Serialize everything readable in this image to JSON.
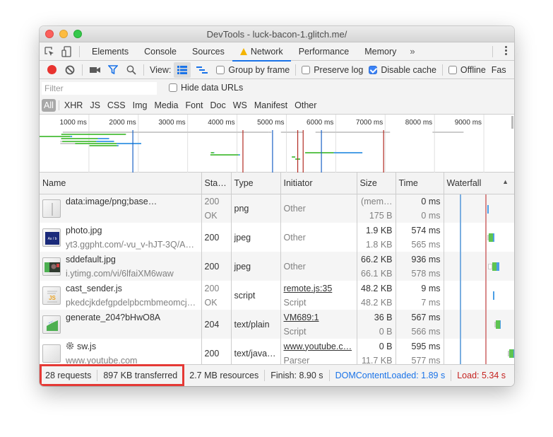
{
  "window": {
    "title": "DevTools - luck-bacon-1.glitch.me/"
  },
  "tabs": [
    {
      "label": "Elements",
      "active": false
    },
    {
      "label": "Console",
      "active": false
    },
    {
      "label": "Sources",
      "active": false
    },
    {
      "label": "Network",
      "active": true,
      "warning": true
    },
    {
      "label": "Performance",
      "active": false
    },
    {
      "label": "Memory",
      "active": false
    }
  ],
  "tabbar": {
    "more_tabs": "»"
  },
  "toolbar": {
    "view_label": "View:",
    "group_by_frame": {
      "label": "Group by frame",
      "checked": false
    },
    "preserve_log": {
      "label": "Preserve log",
      "checked": false
    },
    "disable_cache": {
      "label": "Disable cache",
      "checked": true
    },
    "offline": {
      "label": "Offline",
      "checked": false
    },
    "throttling": "Fas"
  },
  "filter": {
    "placeholder": "Filter",
    "value": "",
    "hide_data_urls": {
      "label": "Hide data URLs",
      "checked": false
    },
    "types": [
      "All",
      "XHR",
      "JS",
      "CSS",
      "Img",
      "Media",
      "Font",
      "Doc",
      "WS",
      "Manifest",
      "Other"
    ],
    "active_type": "All"
  },
  "overview": {
    "ticks": [
      "1000 ms",
      "2000 ms",
      "3000 ms",
      "4000 ms",
      "5000 ms",
      "6000 ms",
      "7000 ms",
      "8000 ms",
      "9000 ms"
    ],
    "dom_content_loaded_ms": 1890,
    "load_ms": 5340,
    "colors": {
      "waiting": "#5ec450",
      "download": "#4c9fe6",
      "queued": "#cccccc",
      "dcl": "#1a62c6",
      "load": "#b22b22"
    }
  },
  "columns": {
    "name": "Name",
    "status": "Sta…",
    "type": "Type",
    "initiator": "Initiator",
    "size": "Size",
    "time": "Time",
    "waterfall": "Waterfall",
    "sort_indicator": "▲"
  },
  "requests": [
    {
      "name": "data:image/png;base…",
      "path": "",
      "thumb": "blank-image",
      "status": "200",
      "status_text": "OK",
      "type": "png",
      "initiator": "Other",
      "initiator_sub": "",
      "initiator_link": false,
      "size": "(mem…",
      "size_sub": "175 B",
      "time": "0 ms",
      "time_sub": "0 ms"
    },
    {
      "name": "photo.jpg",
      "path": "yt3.ggpht.com/-vu_v-hJT-3Q/A…",
      "thumb": "photo-image",
      "status": "200",
      "status_text": "",
      "type": "jpeg",
      "initiator": "Other",
      "initiator_sub": "",
      "initiator_link": false,
      "size": "1.9 KB",
      "size_sub": "1.8 KB",
      "time": "574 ms",
      "time_sub": "565 ms"
    },
    {
      "name": "sddefault.jpg",
      "path": "i.ytimg.com/vi/6lfaiXM6waw",
      "thumb": "video-thumbnail",
      "status": "200",
      "status_text": "",
      "type": "jpeg",
      "initiator": "Other",
      "initiator_sub": "",
      "initiator_link": false,
      "size": "66.2 KB",
      "size_sub": "66.1 KB",
      "time": "936 ms",
      "time_sub": "578 ms"
    },
    {
      "name": "cast_sender.js",
      "path": "pkedcjkdefgpdelpbcmbmeomcj…",
      "thumb": "js-file",
      "status": "200",
      "status_text": "OK",
      "type": "script",
      "initiator": "remote.js:35",
      "initiator_sub": "Script",
      "initiator_link": true,
      "size": "48.2 KB",
      "size_sub": "48.2 KB",
      "time": "9 ms",
      "time_sub": "7 ms"
    },
    {
      "name": "generate_204?bHwO8A",
      "path": "",
      "thumb": "broken-image",
      "status": "204",
      "status_text": "",
      "type": "text/plain",
      "initiator": "VM689:1",
      "initiator_sub": "Script",
      "initiator_link": true,
      "size": "36 B",
      "size_sub": "0 B",
      "time": "567 ms",
      "time_sub": "566 ms"
    },
    {
      "name": "sw.js",
      "path": "www.youtube.com",
      "thumb": "blank-file",
      "gear": true,
      "status": "200",
      "status_text": "",
      "type": "text/java…",
      "initiator": "www.youtube.c…",
      "initiator_sub": "Parser",
      "initiator_link": true,
      "size": "0 B",
      "size_sub": "11.7 KB",
      "time": "595 ms",
      "time_sub": "577 ms"
    }
  ],
  "status_bar": {
    "requests": "28 requests",
    "transferred": "897 KB transferred",
    "resources": "2.7 MB resources",
    "finish": "Finish: 8.90 s",
    "dom_content_loaded": "DOMContentLoaded: 1.89 s",
    "load": "Load: 5.34 s"
  }
}
